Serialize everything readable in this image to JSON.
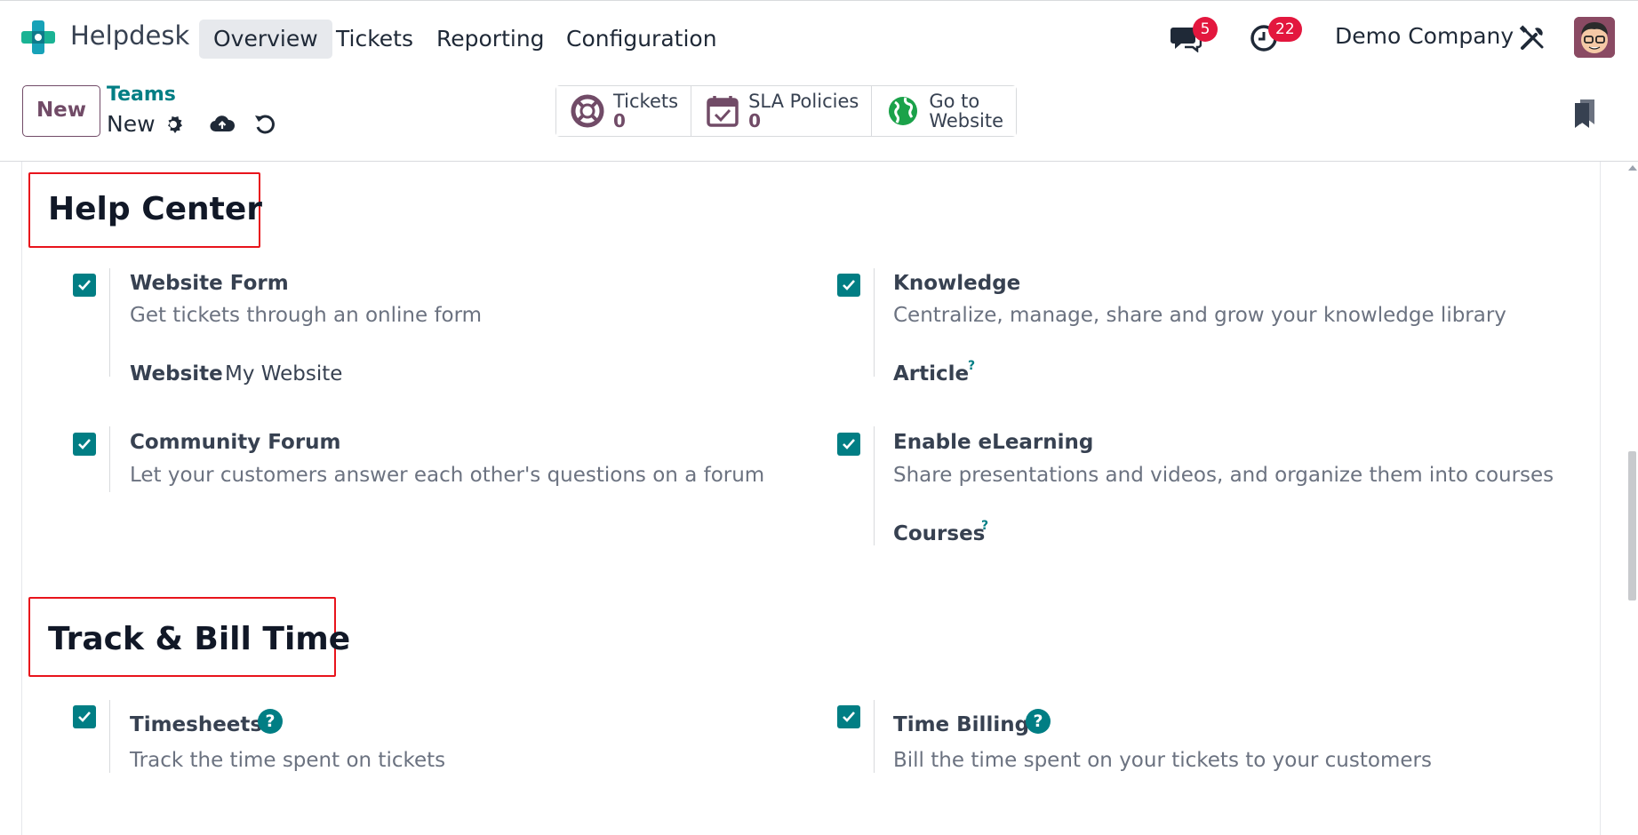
{
  "nav": {
    "app_name": "Helpdesk",
    "menu": [
      "Overview",
      "Tickets",
      "Reporting",
      "Configuration"
    ],
    "active_menu": "Overview",
    "messages_count": "5",
    "activities_count": "22",
    "company": "Demo Company"
  },
  "control_panel": {
    "new_label": "New",
    "breadcrumb_parent": "Teams",
    "breadcrumb_current": "New",
    "smart_buttons": [
      {
        "label": "Tickets",
        "value": "0"
      },
      {
        "label": "SLA Policies",
        "value": "0"
      },
      {
        "label_line1": "Go to",
        "label_line2": "Website"
      }
    ]
  },
  "sections": {
    "help_center": {
      "title": "Help Center",
      "settings": {
        "website_form": {
          "title": "Website Form",
          "desc": "Get tickets through an online form",
          "field_label": "Website",
          "field_value": "My Website"
        },
        "knowledge": {
          "title": "Knowledge",
          "desc": "Centralize, manage, share and grow your knowledge library",
          "field_label": "Article",
          "field_help": "?"
        },
        "community_forum": {
          "title": "Community Forum",
          "desc": "Let your customers answer each other's questions on a forum"
        },
        "elearning": {
          "title": "Enable eLearning",
          "desc": "Share presentations and videos, and organize them into courses",
          "field_label": "Courses",
          "field_help": "?"
        }
      }
    },
    "track_bill": {
      "title": "Track & Bill Time",
      "settings": {
        "timesheets": {
          "title": "Timesheets",
          "desc": "Track the time spent on tickets",
          "help": "?"
        },
        "time_billing": {
          "title": "Time Billing",
          "desc": "Bill the time spent on your tickets to your customers",
          "help": "?"
        }
      }
    }
  },
  "colors": {
    "primary": "#714b67",
    "teal": "#017e84",
    "badge": "#e3173e",
    "highlight_box": "#e8141c"
  }
}
